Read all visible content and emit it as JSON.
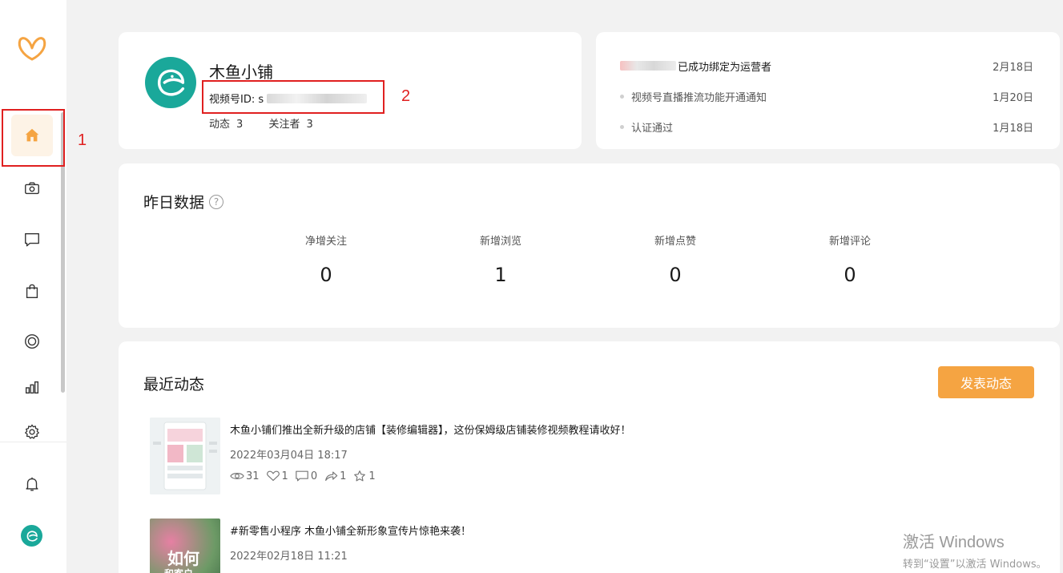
{
  "profile": {
    "name": "木鱼小铺",
    "id_label": "视频号ID: s",
    "posts_label": "动态",
    "posts_count": "3",
    "followers_label": "关注者",
    "followers_count": "3"
  },
  "notices": [
    {
      "text": "已成功绑定为运营者",
      "date": "2月18日"
    },
    {
      "text": "视频号直播推流功能开通通知",
      "date": "1月20日"
    },
    {
      "text": "认证通过",
      "date": "1月18日"
    }
  ],
  "stats": {
    "title": "昨日数据",
    "help": "?",
    "items": [
      {
        "label": "净增关注",
        "value": "0"
      },
      {
        "label": "新增浏览",
        "value": "1"
      },
      {
        "label": "新增点赞",
        "value": "0"
      },
      {
        "label": "新增评论",
        "value": "0"
      }
    ]
  },
  "feed": {
    "title": "最近动态",
    "publish_label": "发表动态",
    "posts": [
      {
        "title": "木鱼小铺们推出全新升级的店铺【装修编辑器】，这份保姆级店铺装修视频教程请收好！",
        "time": "2022年03月04日 18:17",
        "views": "31",
        "likes": "1",
        "comments": "0",
        "shares": "1",
        "favorites": "1"
      },
      {
        "title": "#新零售小程序 木鱼小铺全新形象宣传片惊艳来袭！",
        "time": "2022年02月18日 11:21",
        "thumb_text_1": "如何",
        "thumb_text_2": "和客户"
      }
    ]
  },
  "annotations": {
    "one": "1",
    "two": "2"
  },
  "watermark": {
    "line1": "激活 Windows",
    "line2": "转到“设置”以激活 Windows。"
  },
  "colors": {
    "accent": "#f5a442",
    "brand": "#1aa89a",
    "annotation": "#e02020"
  }
}
